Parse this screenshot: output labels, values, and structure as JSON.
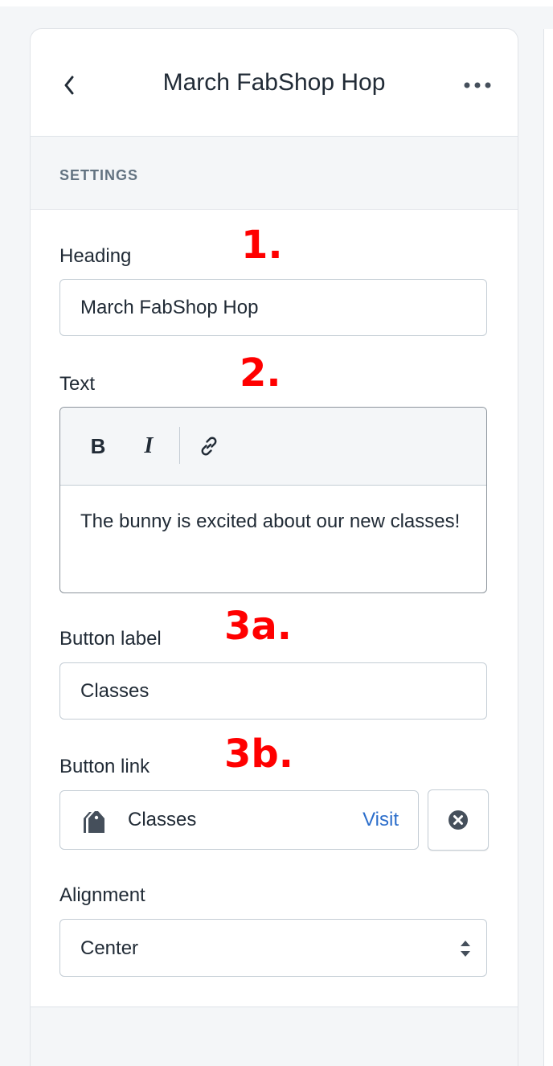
{
  "header": {
    "title": "March FabShop Hop",
    "back_icon": "chevron-left-icon",
    "more_icon": "more-horizontal-icon"
  },
  "section": {
    "label": "SETTINGS"
  },
  "fields": {
    "heading": {
      "label": "Heading",
      "value": "March FabShop Hop"
    },
    "text": {
      "label": "Text",
      "toolbar": {
        "bold": "B",
        "italic": "I",
        "link_icon": "link-icon"
      },
      "content": "The bunny is excited about our new classes!"
    },
    "button_label": {
      "label": "Button label",
      "value": "Classes"
    },
    "button_link": {
      "label": "Button link",
      "value": "Classes",
      "visit": "Visit",
      "icon": "tag-icon",
      "clear_icon": "clear-circle-icon"
    },
    "alignment": {
      "label": "Alignment",
      "value": "Center",
      "icon": "select-arrows-icon"
    }
  },
  "annotations": {
    "a1": "1.",
    "a2": "2.",
    "a3a": "3a.",
    "a3b": "3b."
  },
  "colors": {
    "annotation": "#ff0000",
    "link": "#2c6ecb",
    "section_bg": "#f4f6f8"
  }
}
